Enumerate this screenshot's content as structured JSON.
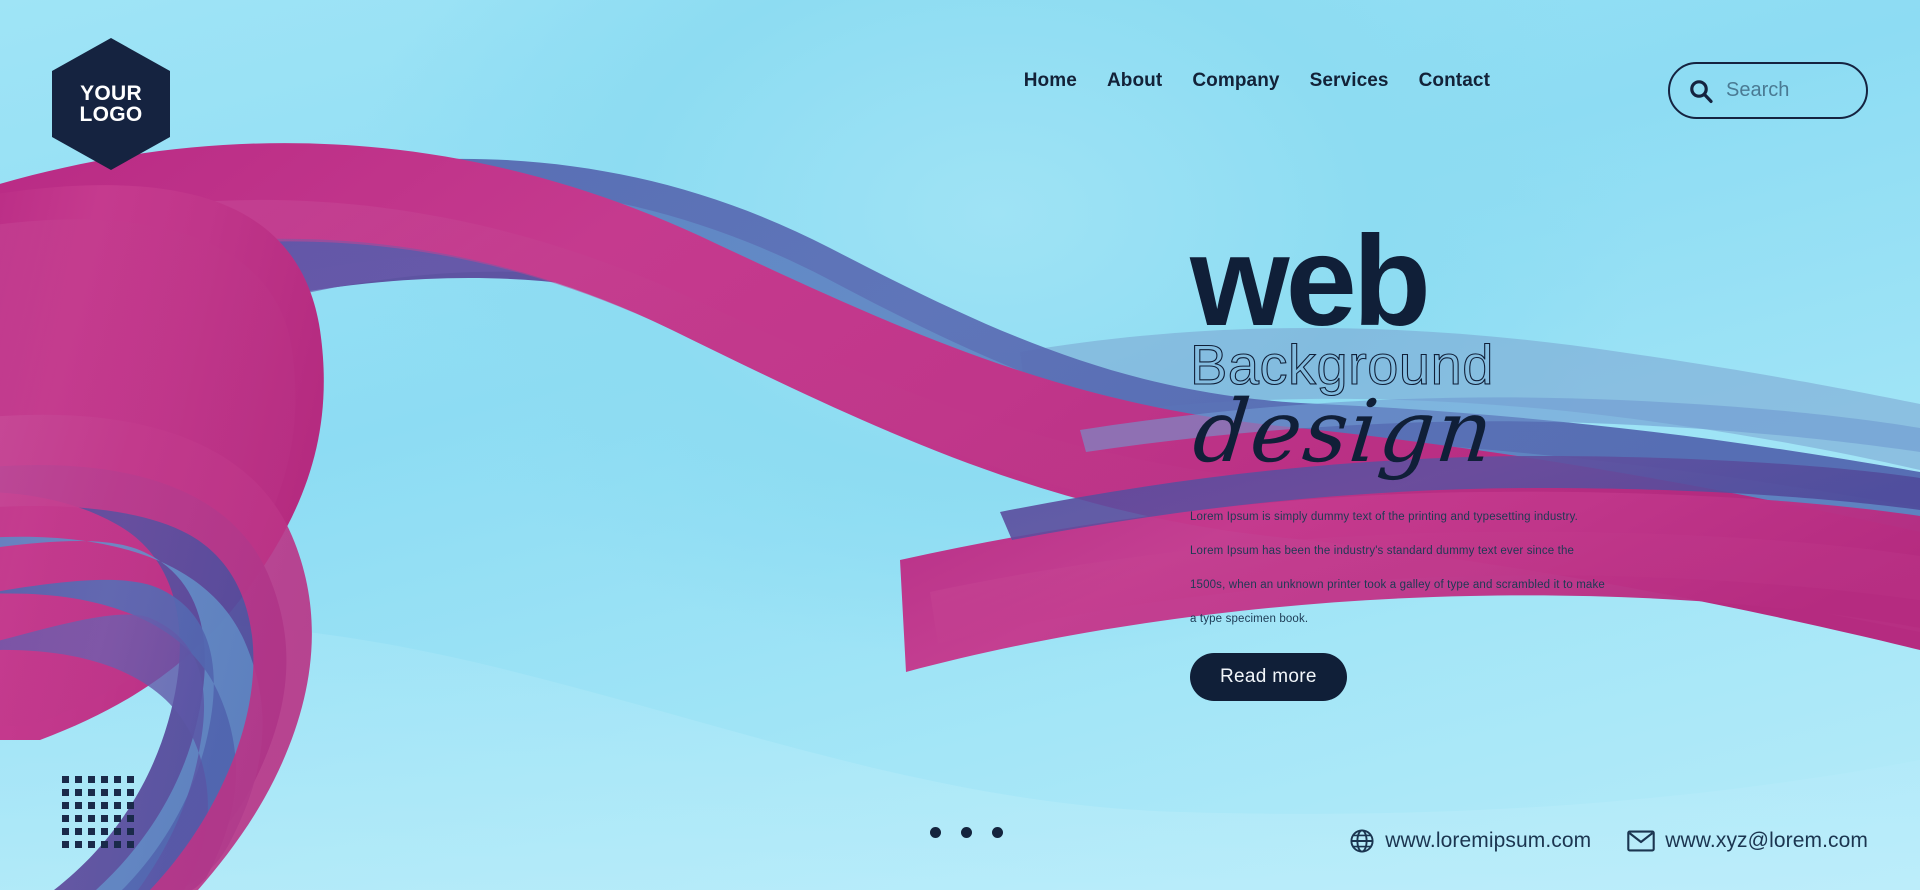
{
  "brand": {
    "logo_line1": "YOUR",
    "logo_line2": "LOGO",
    "logo_color": "#152340"
  },
  "nav": {
    "items": [
      {
        "label": "Home"
      },
      {
        "label": "About"
      },
      {
        "label": "Company"
      },
      {
        "label": "Services"
      },
      {
        "label": "Contact"
      }
    ]
  },
  "search": {
    "placeholder": "Search",
    "value": "",
    "icon": "search-icon"
  },
  "hero": {
    "title_primary": "web",
    "title_secondary": "Background",
    "title_script": "design",
    "paragraph": "Lorem Ipsum is simply dummy text of the printing and typesetting industry. Lorem Ipsum has been the industry's standard dummy text ever since the 1500s, when an unknown printer took a galley of type and scrambled it to make a type specimen book.",
    "cta_label": "Read more",
    "text_color": "#101f38"
  },
  "footer": {
    "website": "www.loremipsum.com",
    "email": "www.xyz@lorem.com",
    "website_icon": "globe-icon",
    "email_icon": "envelope-icon"
  },
  "decor": {
    "carousel_dot_count": 3,
    "dot_grid_rows": 6,
    "dot_grid_cols": 6
  },
  "palette": {
    "background_light": "#8ddcf3",
    "background_pale": "#b6ebf9",
    "magenta": "#bf2a85",
    "pink": "#cc4294",
    "purple": "#5b4a9e",
    "violet": "#6a5aa8",
    "steel_blue": "#5b82c0",
    "slate_blue": "#5160a8",
    "navy": "#101f38"
  }
}
